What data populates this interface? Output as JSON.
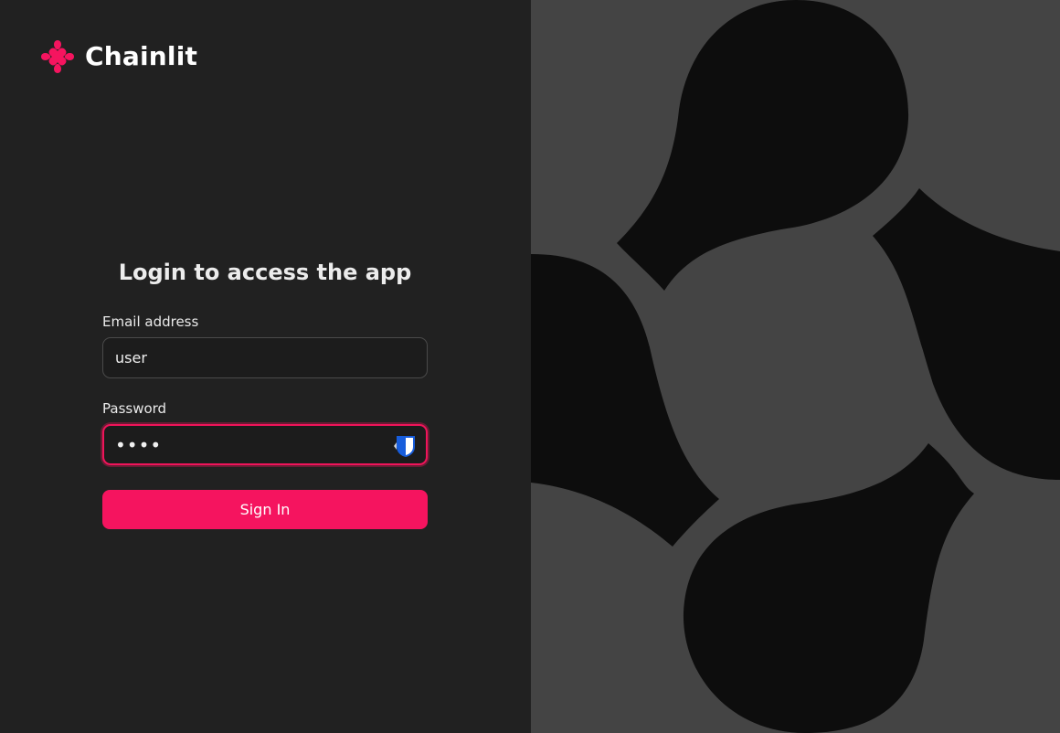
{
  "brand": {
    "name": "Chainlit",
    "icon": "chainlit-logo-icon",
    "accent_color": "#f5145f"
  },
  "form": {
    "title": "Login to access the app",
    "email": {
      "label": "Email address",
      "value": "user"
    },
    "password": {
      "label": "Password",
      "masked_value": "••••",
      "manager_icon": "bitwarden-shield-icon"
    },
    "submit_label": "Sign In"
  },
  "background": {
    "left_color": "#212121",
    "right_color": "#444444",
    "shape_color": "#0d0d0d"
  }
}
